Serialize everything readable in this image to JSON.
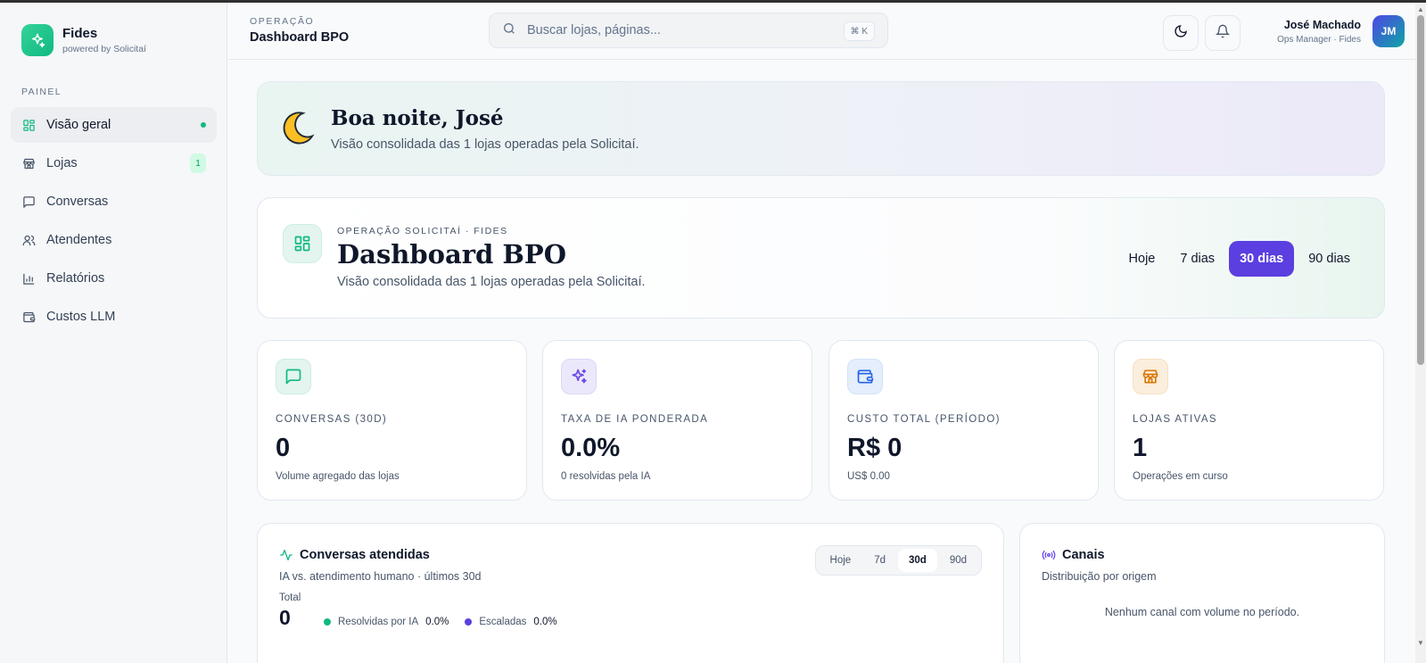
{
  "brand": {
    "name": "Fides",
    "tagline": "powered by Solicitaí"
  },
  "sidebar": {
    "section_label": "PAINEL",
    "items": [
      {
        "label": "Visão geral",
        "icon": "grid-icon",
        "active": true
      },
      {
        "label": "Lojas",
        "icon": "store-icon",
        "badge": "1"
      },
      {
        "label": "Conversas",
        "icon": "chat-icon"
      },
      {
        "label": "Atendentes",
        "icon": "users-icon"
      },
      {
        "label": "Relatórios",
        "icon": "bar-chart-icon"
      },
      {
        "label": "Custos LLM",
        "icon": "wallet-icon"
      }
    ]
  },
  "header": {
    "eyebrow": "OPERAÇÃO",
    "title": "Dashboard BPO",
    "search_placeholder": "Buscar lojas, páginas...",
    "search_shortcut": "⌘ K",
    "user_name": "José Machado",
    "user_role": "Ops Manager · Fides",
    "user_initials": "JM"
  },
  "greeting": {
    "title": "Boa noite, José",
    "subtitle": "Visão consolidada das 1 lojas operadas pela Solicitaí."
  },
  "dashboard": {
    "eyebrow": "OPERAÇÃO SOLICITAÍ · FIDES",
    "title": "Dashboard BPO",
    "subtitle": "Visão consolidada das 1 lojas operadas pela Solicitaí.",
    "periods": [
      "Hoje",
      "7 dias",
      "30 dias",
      "90 dias"
    ],
    "active_period": "30 dias"
  },
  "kpis": [
    {
      "label": "CONVERSAS (30D)",
      "value": "0",
      "sub": "Volume agregado das lojas",
      "icon": "chat-icon",
      "color": "#10b981"
    },
    {
      "label": "TAXA DE IA PONDERADA",
      "value": "0.0%",
      "sub": "0 resolvidas pela IA",
      "icon": "sparkles-icon",
      "color": "#6d4ae8"
    },
    {
      "label": "CUSTO TOTAL (PERÍODO)",
      "value": "R$ 0",
      "sub": "US$ 0.00",
      "icon": "wallet-icon",
      "color": "#2563eb"
    },
    {
      "label": "LOJAS ATIVAS",
      "value": "1",
      "sub": "Operações em curso",
      "icon": "store-icon",
      "color": "#d97706"
    }
  ],
  "conversations_panel": {
    "title": "Conversas atendidas",
    "subtitle": "IA vs. atendimento humano · últimos 30d",
    "ranges": [
      "Hoje",
      "7d",
      "30d",
      "90d"
    ],
    "active_range": "30d",
    "total_label": "Total",
    "total_value": "0",
    "legend": [
      {
        "label": "Resolvidas por IA",
        "value": "0.0%",
        "color": "#10b981"
      },
      {
        "label": "Escaladas",
        "value": "0.0%",
        "color": "#5b3fe0"
      }
    ]
  },
  "channels_panel": {
    "title": "Canais",
    "subtitle": "Distribuição por origem",
    "empty_text": "Nenhum canal com volume no período."
  }
}
